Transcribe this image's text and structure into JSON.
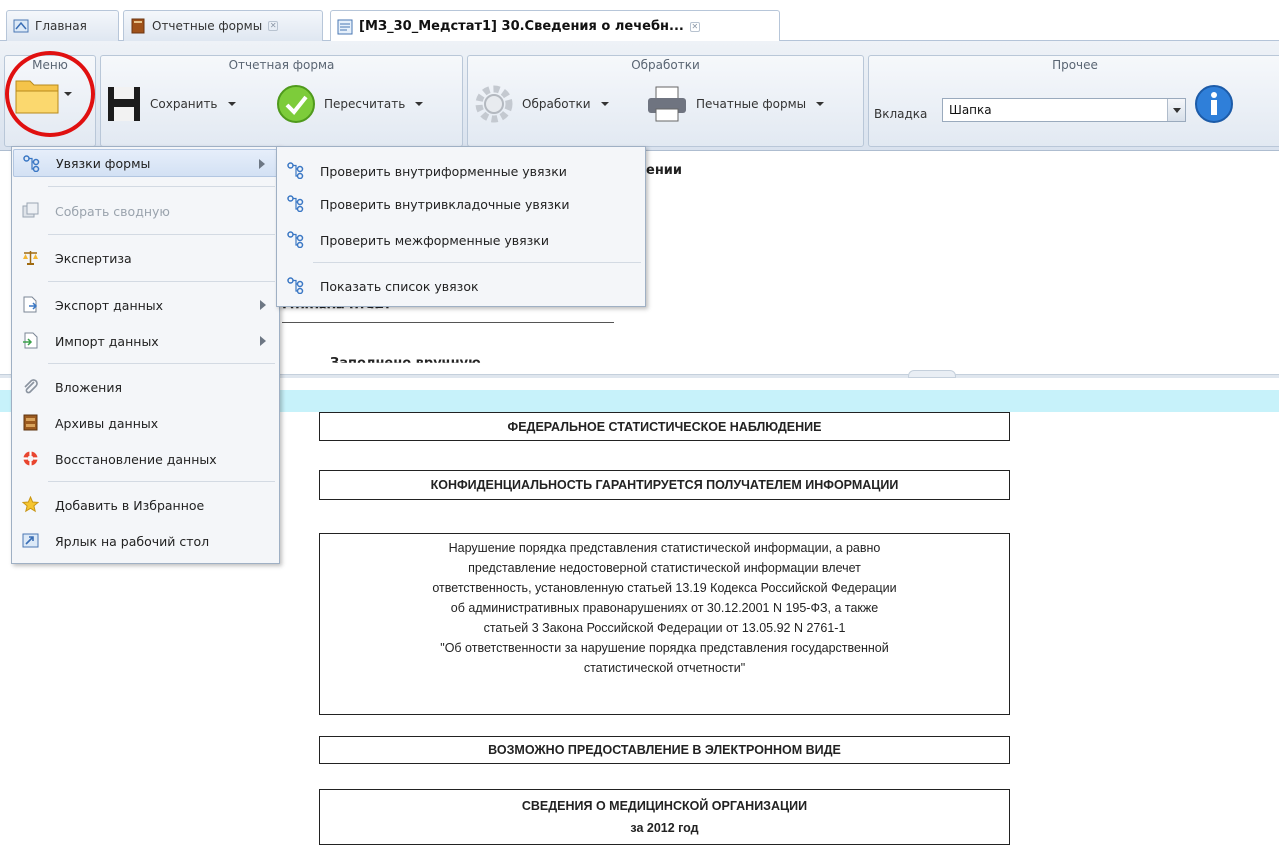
{
  "tabs": [
    {
      "label": "Главная"
    },
    {
      "label": "Отчетные формы"
    },
    {
      "label": "[МЗ_30_Медстат1] 30.Сведения о лечебн..."
    }
  ],
  "ribbon": {
    "groups": {
      "menu": "Меню",
      "report_form": "Отчетная форма",
      "processing": "Обработки",
      "other": "Прочее"
    },
    "buttons": {
      "save": "Сохранить",
      "recalc": "Пересчитать",
      "processing": "Обработки",
      "print_forms": "Печатные формы"
    },
    "tab_selector": {
      "label": "Вкладка",
      "value": "Шапка"
    }
  },
  "menu": {
    "items": [
      {
        "label": "Увязки формы"
      },
      {
        "label": "Собрать сводную"
      },
      {
        "label": "Экспертиза"
      },
      {
        "label": "Экспорт данных"
      },
      {
        "label": "Импорт данных"
      },
      {
        "label": "Вложения"
      },
      {
        "label": "Архивы данных"
      },
      {
        "label": "Восстановление данных"
      },
      {
        "label": "Добавить в Избранное"
      },
      {
        "label": "Ярлык на рабочий стол"
      }
    ]
  },
  "submenu": {
    "items": [
      {
        "label": "Проверить внутриформенные увязки"
      },
      {
        "label": "Проверить внутривкладочные увязки"
      },
      {
        "label": "Проверить межформенные увязки"
      },
      {
        "label": "Показать список увязок"
      }
    ]
  },
  "form_top": {
    "partial_heading": "ении",
    "partial_annual": "Годовой отчет",
    "partial_filled": "Заполнено вручную"
  },
  "document": {
    "federal": "ФЕДЕРАЛЬНОЕ СТАТИСТИЧЕСКОЕ НАБЛЮДЕНИЕ",
    "confidential": "КОНФИДЕНЦИАЛЬНОСТЬ ГАРАНТИРУЕТСЯ ПОЛУЧАТЕЛЕМ ИНФОРМАЦИИ",
    "violation_lines": [
      "Нарушение порядка представления статистической информации, а равно",
      "представление недостоверной статистической информации влечет",
      "ответственность, установленную статьей 13.19 Кодекса Российской Федерации",
      "об административных правонарушениях от 30.12.2001 N 195-ФЗ, а также",
      "статьей 3 Закона Российской Федерации от 13.05.92 N 2761-1",
      "\"Об ответственности за нарушение порядка представления государственной",
      "статистической отчетности\""
    ],
    "electronic": "ВОЗМОЖНО ПРЕДОСТАВЛЕНИЕ В ЭЛЕКТРОННОМ ВИДЕ",
    "info_title": "СВЕДЕНИЯ О МЕДИЦИНСКОЙ ОРГАНИЗАЦИИ",
    "info_year": "за 2012 год"
  },
  "colors": {
    "highlight_circle": "#e01010",
    "cyan_bar": "#c7f2fa",
    "ribbon_bg": "#e2e9f2"
  }
}
